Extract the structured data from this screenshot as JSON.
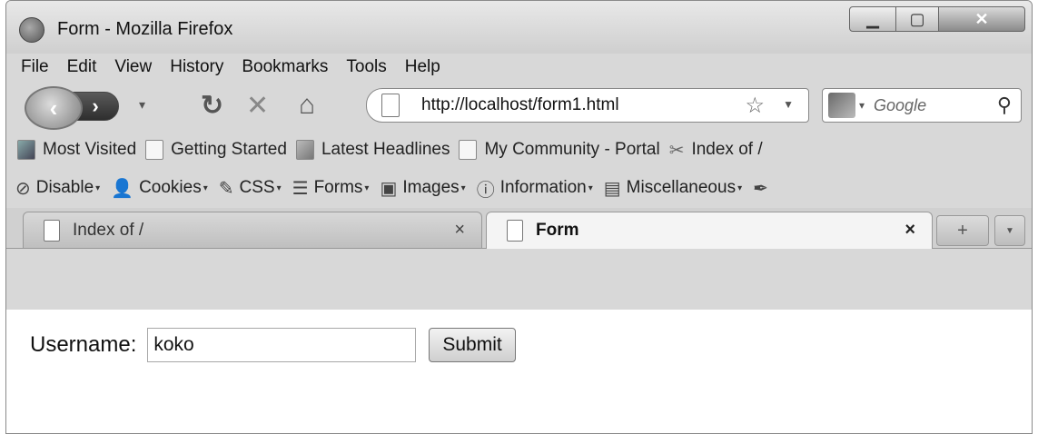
{
  "window": {
    "title": "Form - Mozilla Firefox"
  },
  "menu": [
    "File",
    "Edit",
    "View",
    "History",
    "Bookmarks",
    "Tools",
    "Help"
  ],
  "navigation": {
    "url": "http://localhost/form1.html",
    "search_placeholder": "Google"
  },
  "bookmarks": [
    "Most Visited",
    "Getting Started",
    "Latest Headlines",
    "My Community - Portal",
    "Index of /"
  ],
  "dev_toolbar": [
    "Disable",
    "Cookies",
    "CSS",
    "Forms",
    "Images",
    "Information",
    "Miscellaneous"
  ],
  "tabs": [
    {
      "label": "Index of /",
      "active": false
    },
    {
      "label": "Form",
      "active": true
    }
  ],
  "form": {
    "label": "Username:",
    "username_value": "koko",
    "submit_label": "Submit"
  }
}
